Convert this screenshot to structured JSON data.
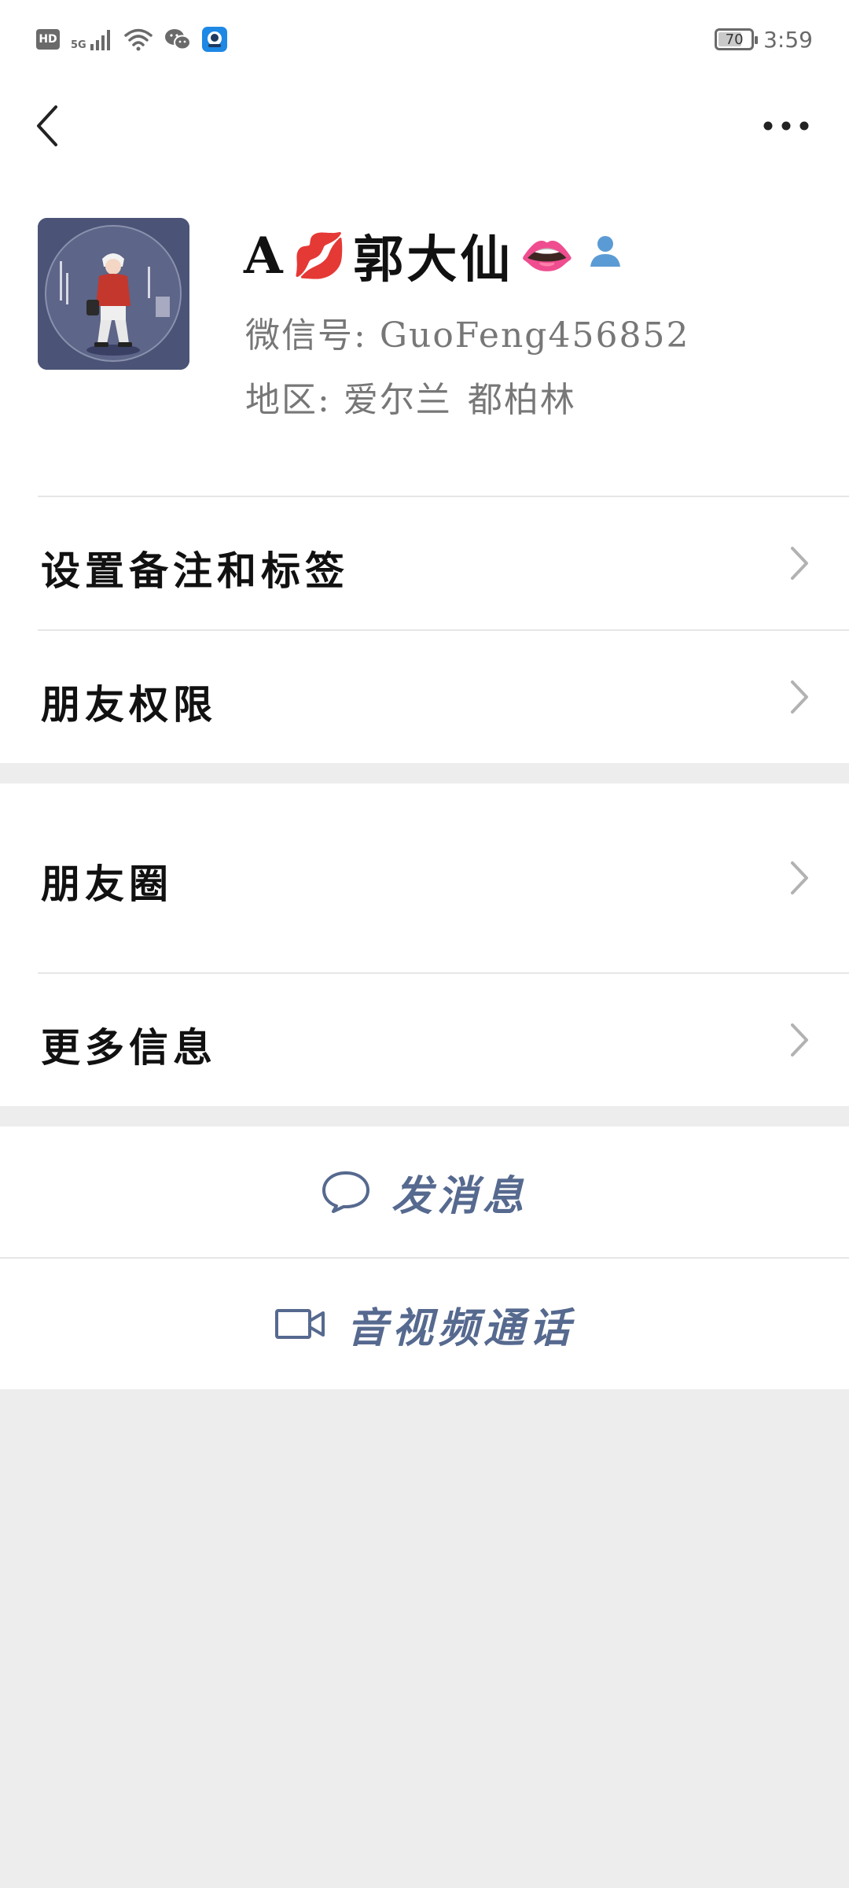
{
  "status_bar": {
    "hd": "HD",
    "network": "5G",
    "battery": "70",
    "time": "3:59"
  },
  "profile": {
    "name_prefix": "A",
    "name_main": "郭大仙",
    "name_emoji_1": "💋",
    "name_emoji_2": "👄",
    "wechat_id_label": "微信号:",
    "wechat_id": "GuoFeng456852",
    "region_label": "地区:",
    "region_country": "爱尔兰",
    "region_city": "都柏林"
  },
  "menu": {
    "remark_tags": "设置备注和标签",
    "friend_permissions": "朋友权限",
    "moments": "朋友圈",
    "more_info": "更多信息"
  },
  "actions": {
    "send_message": "发消息",
    "video_call": "音视频通话"
  },
  "colors": {
    "accent": "#56698f",
    "background": "#ededed",
    "badge_blue": "#5b9bd5"
  }
}
